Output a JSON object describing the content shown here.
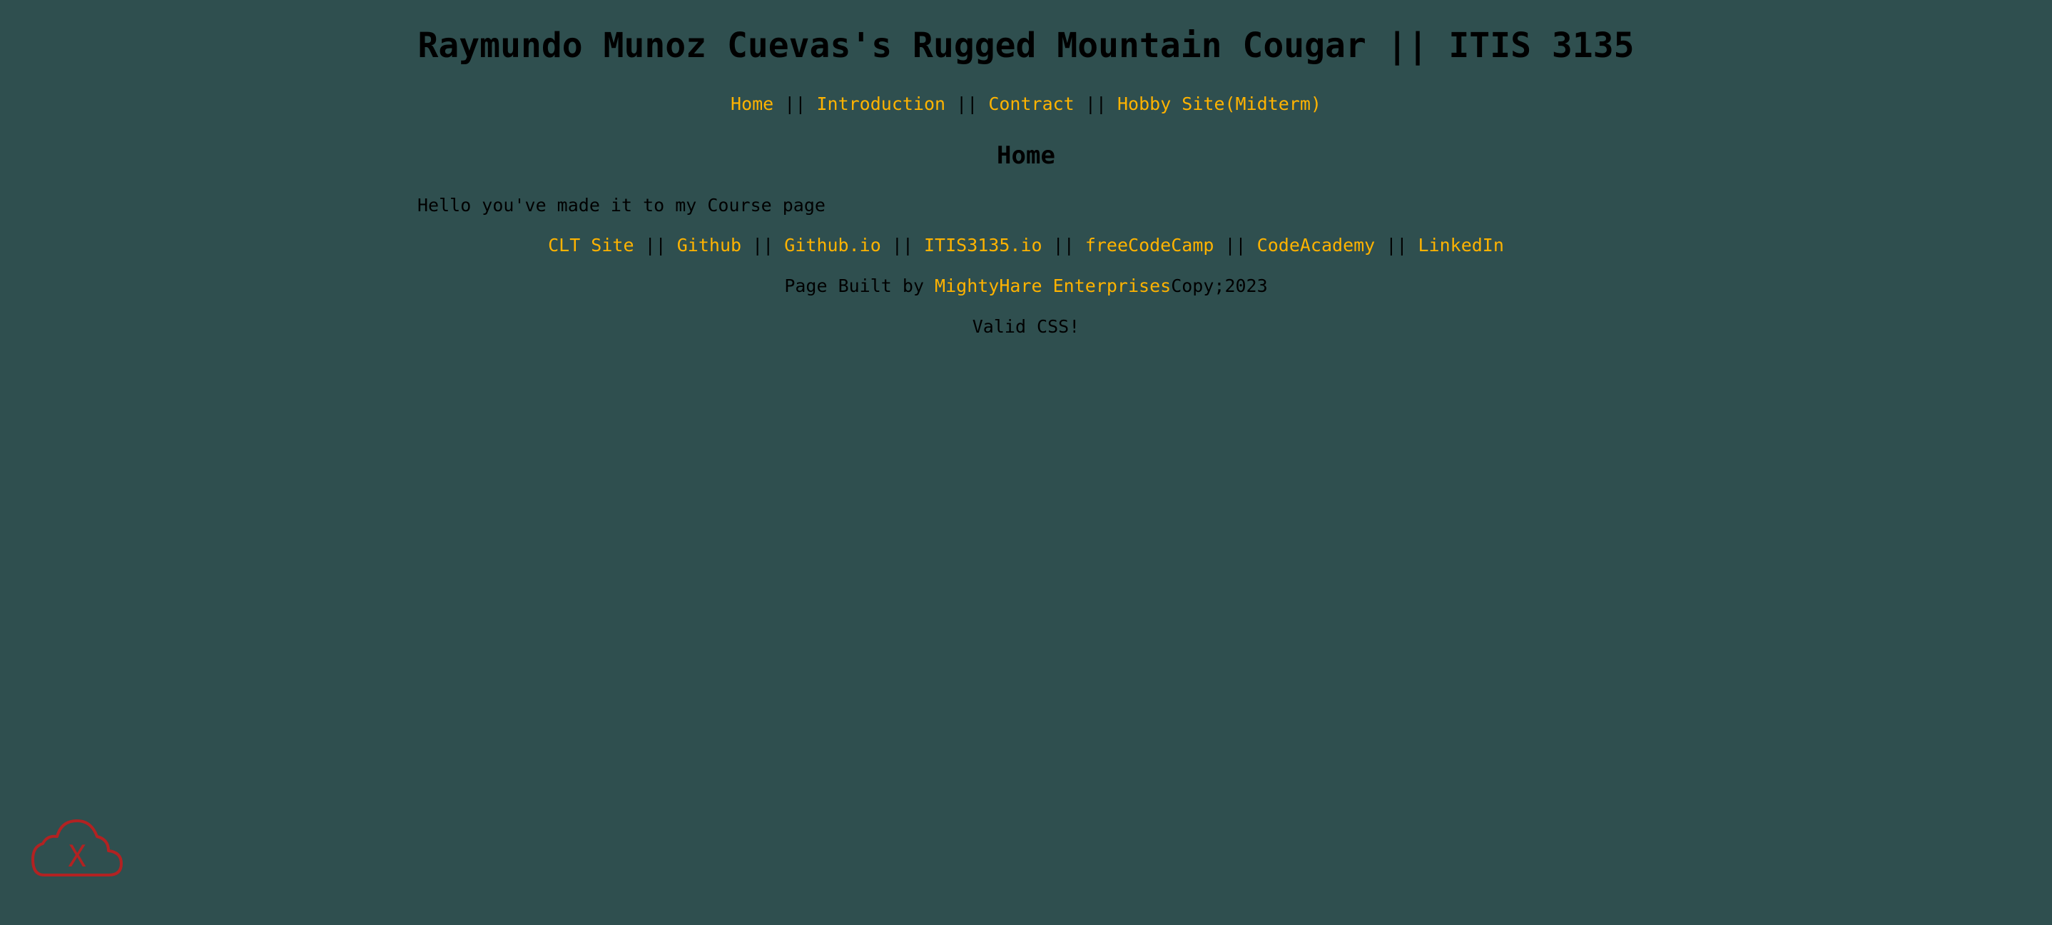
{
  "header": {
    "title": "Raymundo Munoz Cuevas's Rugged Mountain Cougar || ITIS 3135"
  },
  "nav": {
    "items": [
      {
        "label": "Home"
      },
      {
        "label": "Introduction"
      },
      {
        "label": "Contract"
      },
      {
        "label": "Hobby Site(Midterm)"
      }
    ],
    "separator": "||"
  },
  "main": {
    "heading": "Home",
    "intro": "Hello you've made it to my Course page"
  },
  "footer": {
    "links": [
      {
        "label": "CLT Site"
      },
      {
        "label": "Github"
      },
      {
        "label": "Github.io"
      },
      {
        "label": "ITIS3135.io"
      },
      {
        "label": "freeCodeCamp"
      },
      {
        "label": "CodeAcademy"
      },
      {
        "label": "LinkedIn"
      }
    ],
    "separator": "||",
    "built_by_prefix": "Page Built by ",
    "built_by_link": "MightyHare Enterprises",
    "copyright": "Copy;2023",
    "valid_css": "Valid CSS!"
  },
  "badge": {
    "icon": "cloud-x-icon",
    "letter": "X",
    "color": "#b22222"
  },
  "colors": {
    "background": "#2f4f4f",
    "link": "#ffb300",
    "text": "#000000"
  }
}
